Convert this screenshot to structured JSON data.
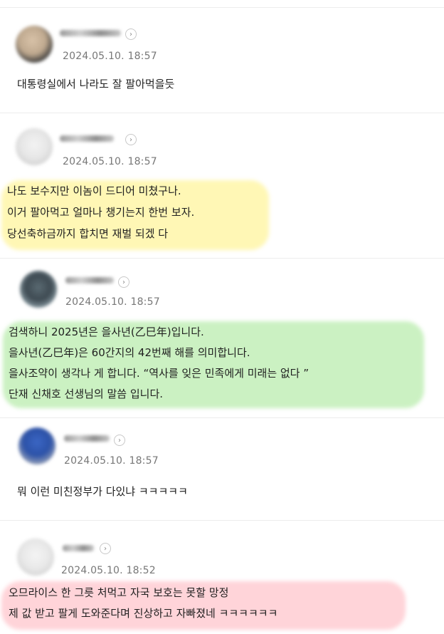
{
  "colors": {
    "yellow_highlight": "#fff078",
    "green_highlight": "#8ce178",
    "pink_highlight": "#ffa0aa",
    "date_text": "#777777"
  },
  "comments": [
    {
      "date": "2024.05.10. 18:57",
      "lines": [
        "대통령실에서 나라도 잘 팔아먹을듯"
      ],
      "highlight": "none"
    },
    {
      "date": "2024.05.10. 18:57",
      "lines": [
        "나도 보수지만 이놈이 드디어 미쳤구나.",
        "이거 팔아먹고 얼마나 챙기는지 한번 보자.",
        "당선축하금까지 합치면 재벌 되겠 다"
      ],
      "highlight": "yellow"
    },
    {
      "date": "2024.05.10. 18:57",
      "lines": [
        "검색하니 2025년은 을사년(乙巳年)입니다.",
        "을사년(乙巳年)은 60간지의 42번째 해를 의미합니다.",
        "을사조약이 생각나 게 합니다. “역사를 잊은 민족에게 미래는 없다 ”",
        "단재 신채호 선생님의 말씀 입니다."
      ],
      "highlight": "green"
    },
    {
      "date": "2024.05.10. 18:57",
      "lines": [
        "뭐 이런 미친정부가 다있냐 ㅋㅋㅋㅋㅋ"
      ],
      "highlight": "none"
    },
    {
      "date": "2024.05.10. 18:52",
      "lines": [
        "오므라이스 한 그릇 처먹고 자국 보호는 못할 망정",
        "제 값 받고 팔게 도와준다며 진상하고 자빠졌네 ㅋㅋㅋㅋㅋㅋ"
      ],
      "highlight": "pink"
    }
  ],
  "icons": {
    "profile_arrow": "›"
  }
}
